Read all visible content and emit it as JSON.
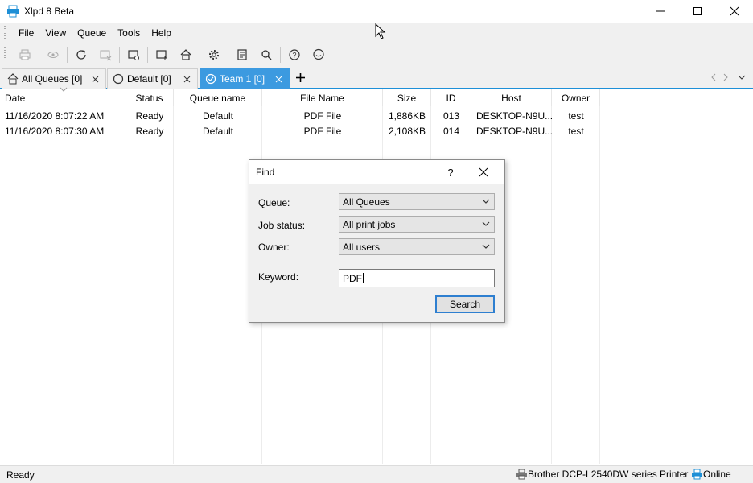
{
  "window": {
    "title": "Xlpd 8 Beta"
  },
  "menu": [
    "File",
    "View",
    "Queue",
    "Tools",
    "Help"
  ],
  "tabs": [
    {
      "label": "All Queues [0]",
      "icon": "home-icon",
      "active": false
    },
    {
      "label": "Default [0]",
      "icon": "circle-icon",
      "active": false
    },
    {
      "label": "Team 1 [0]",
      "icon": "check-circle-icon",
      "active": true
    }
  ],
  "table": {
    "headers": [
      "Date",
      "Status",
      "Queue name",
      "File Name",
      "Size",
      "ID",
      "Host",
      "Owner"
    ],
    "rows": [
      [
        "11/16/2020 8:07:22 AM",
        "Ready",
        "Default",
        "PDF File",
        "1,886KB",
        "013",
        "DESKTOP-N9U...",
        "test"
      ],
      [
        "11/16/2020 8:07:30 AM",
        "Ready",
        "Default",
        "PDF File",
        "2,108KB",
        "014",
        "DESKTOP-N9U...",
        "test"
      ]
    ]
  },
  "status": {
    "left": "Ready",
    "printer": "Brother DCP-L2540DW series Printer",
    "connection": "Online"
  },
  "find_dialog": {
    "title": "Find",
    "help": "?",
    "queue_label": "Queue:",
    "queue_value": "All Queues",
    "job_status_label": "Job status:",
    "job_status_value": "All print jobs",
    "owner_label": "Owner:",
    "owner_value": "All users",
    "keyword_label": "Keyword:",
    "keyword_value": "PDF",
    "search_label": "Search"
  },
  "colors": {
    "accent": "#3c9ae0",
    "focus_border": "#2e7fd0",
    "app_icon": "#1e8fd6"
  }
}
